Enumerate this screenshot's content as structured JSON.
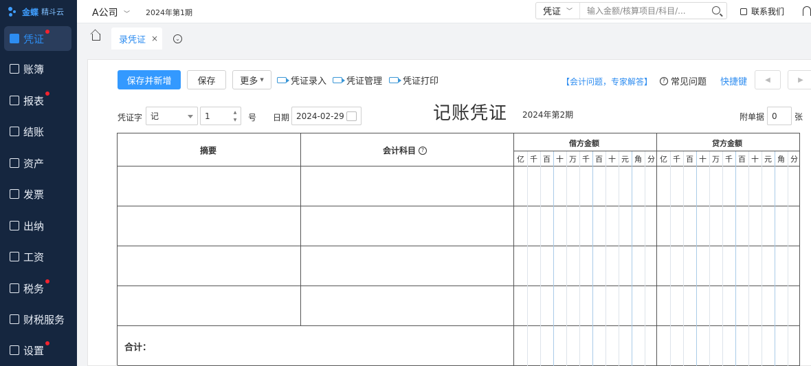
{
  "brand": {
    "name": "金蝶",
    "sub": "精斗云"
  },
  "sidebar": {
    "items": [
      {
        "label": "凭证",
        "icon": "voucher-icon",
        "badge": true,
        "active": true
      },
      {
        "label": "账簿",
        "icon": "ledger-icon",
        "badge": false
      },
      {
        "label": "报表",
        "icon": "report-icon",
        "badge": true
      },
      {
        "label": "结账",
        "icon": "closing-icon",
        "badge": false
      },
      {
        "label": "资产",
        "icon": "asset-icon",
        "badge": false
      },
      {
        "label": "发票",
        "icon": "invoice-icon",
        "badge": false
      },
      {
        "label": "出纳",
        "icon": "cashier-icon",
        "badge": false
      },
      {
        "label": "工资",
        "icon": "salary-icon",
        "badge": false
      },
      {
        "label": "税务",
        "icon": "tax-icon",
        "badge": true
      },
      {
        "label": "财税服务",
        "icon": "service-icon",
        "badge": false
      },
      {
        "label": "设置",
        "icon": "settings-icon",
        "badge": true
      }
    ]
  },
  "header": {
    "company": "A公司",
    "period": "2024年第1期",
    "search_type": "凭证",
    "search_placeholder": "输入金额/核算项目/科目/...",
    "contact": "联系我们"
  },
  "tabs": {
    "active": "录凭证",
    "close": "×"
  },
  "toolbar": {
    "save_new": "保存并新增",
    "save": "保存",
    "more": "更多",
    "entry": "凭证录入",
    "manage": "凭证管理",
    "print": "凭证打印",
    "faq_link": "【会计问题，专家解答】",
    "faq": "常见问题",
    "shortcut": "快捷键"
  },
  "voucher": {
    "word_label": "凭证字",
    "word_value": "记",
    "number_value": "1",
    "number_unit": "号",
    "date_label": "日期",
    "date_value": "2024-02-29",
    "title": "记账凭证",
    "period": "2024年第2期",
    "attach_label": "附单据",
    "attach_value": "0",
    "attach_unit": "张"
  },
  "table": {
    "col_summary": "摘要",
    "col_account": "会计科目",
    "col_debit": "借方金额",
    "col_credit": "贷方金额",
    "digits": [
      "亿",
      "千",
      "百",
      "十",
      "万",
      "千",
      "百",
      "十",
      "元",
      "角",
      "分"
    ],
    "total_label": "合计："
  },
  "colors": {
    "accent": "#3399ff",
    "sidebar_bg": "#15263f",
    "badge": "#f5222d"
  }
}
